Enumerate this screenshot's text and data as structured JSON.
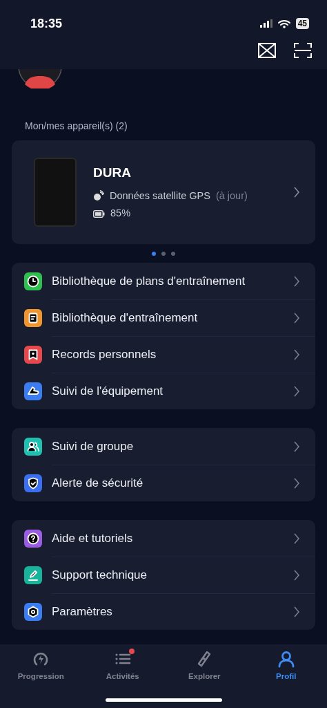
{
  "status_bar": {
    "time": "18:35",
    "battery": "45"
  },
  "section_label": "Mon/mes appareil(s) (2)",
  "device": {
    "name": "DURA",
    "gps_label": "Données satellite GPS",
    "gps_status": "(à jour)",
    "battery": "85%"
  },
  "carousel_pages": [
    {
      "selected": true
    },
    {
      "selected": false
    },
    {
      "selected": false
    }
  ],
  "menu_groups": [
    {
      "items": [
        {
          "label": "Bibliothèque de plans d'entraînement",
          "color": "#2fbf4f"
        },
        {
          "label": "Bibliothèque d'entraînement",
          "color": "#f0962e"
        },
        {
          "label": "Records personnels",
          "color": "#e5484d"
        },
        {
          "label": "Suivi de l'équipement",
          "color": "#3b7cf0"
        }
      ]
    },
    {
      "items": [
        {
          "label": "Suivi de groupe",
          "color": "#1fc0b0"
        },
        {
          "label": "Alerte de sécurité",
          "color": "#3b6ff0"
        }
      ]
    },
    {
      "items": [
        {
          "label": "Aide et tutoriels",
          "color": "#9a5ce0"
        },
        {
          "label": "Support technique",
          "color": "#17b39a"
        },
        {
          "label": "Paramètres",
          "color": "#3b7cf0"
        }
      ]
    }
  ],
  "tabs": [
    {
      "label": "Progression",
      "selected": false,
      "badge": false
    },
    {
      "label": "Activités",
      "selected": false,
      "badge": true
    },
    {
      "label": "Explorer",
      "selected": false,
      "badge": false
    },
    {
      "label": "Profil",
      "selected": true,
      "badge": false
    }
  ]
}
